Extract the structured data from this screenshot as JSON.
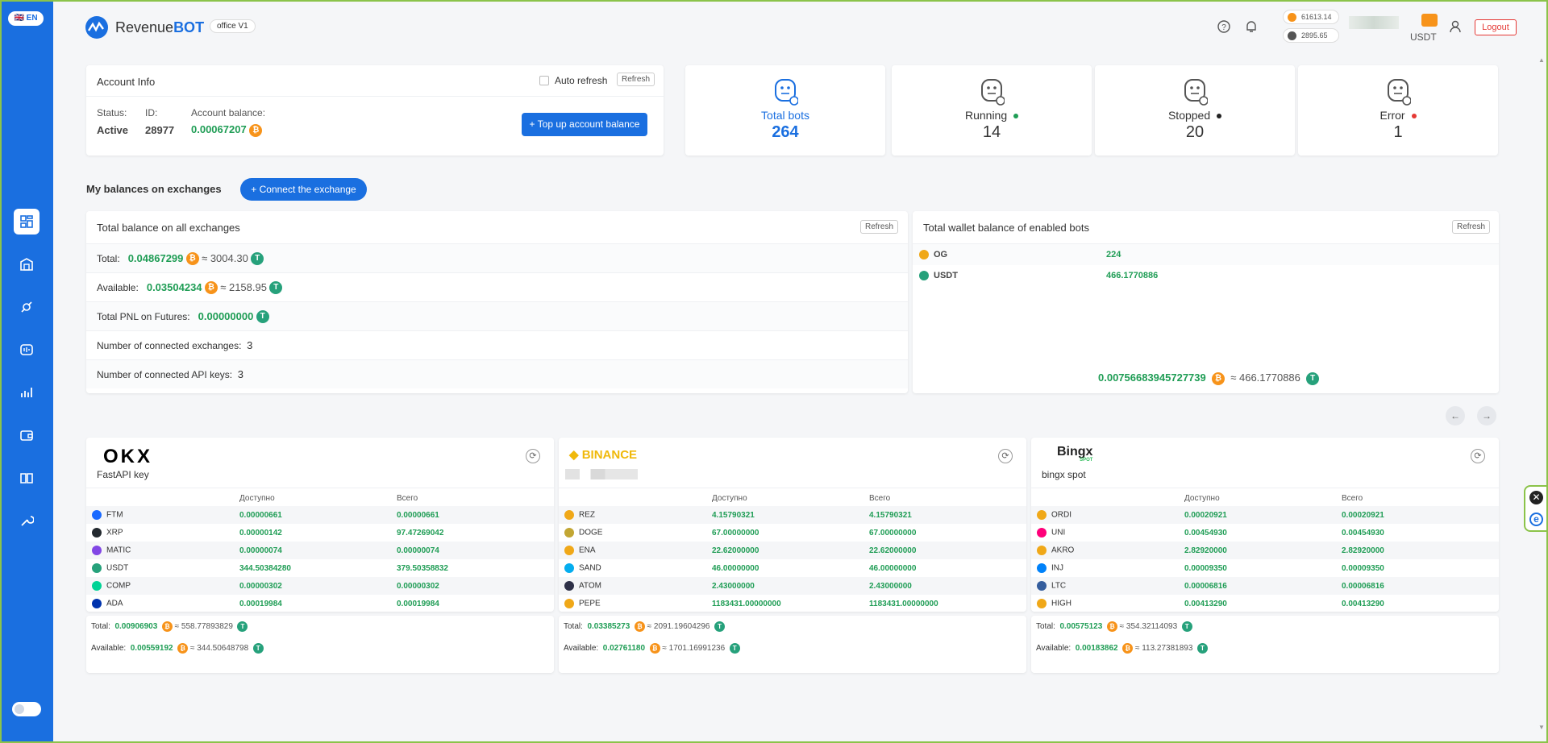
{
  "sidebar": {
    "lang": "🇬🇧 EN"
  },
  "header": {
    "logo_text": "Revenue",
    "logo_bold": "BOT",
    "office": "office V1",
    "btc_price": "61613.14",
    "eth_price": "2895.65",
    "currency": "USDT",
    "logout": "Logout"
  },
  "account": {
    "title": "Account Info",
    "auto_refresh": "Auto refresh",
    "refresh": "Refresh",
    "status_label": "Status:",
    "status_value": "Active",
    "id_label": "ID:",
    "id_value": "28977",
    "balance_label": "Account balance:",
    "balance_value": "0.00067207",
    "topup": "+ Top up account balance"
  },
  "stats": [
    {
      "label": "Total bots",
      "value": "264",
      "dot": ""
    },
    {
      "label": "Running",
      "value": "14",
      "dot": "#1f9d55"
    },
    {
      "label": "Stopped",
      "value": "20",
      "dot": "#222222"
    },
    {
      "label": "Error",
      "value": "1",
      "dot": "#e53935"
    }
  ],
  "balances": {
    "section_title": "My balances on exchanges",
    "connect": "+ Connect the exchange",
    "total_title": "Total balance on all exchanges",
    "refresh": "Refresh",
    "total_label": "Total:",
    "total_btc": "0.04867299",
    "total_usdt": "≈ 3004.30",
    "available_label": "Available:",
    "available_btc": "0.03504234",
    "available_usdt": "≈ 2158.95",
    "pnl_label": "Total PNL on Futures:",
    "pnl_value": "0.00000000",
    "exchanges_label": "Number of connected exchanges:",
    "exchanges_value": "3",
    "api_label": "Number of connected API keys:",
    "api_value": "3"
  },
  "wallet": {
    "title": "Total wallet balance of enabled bots",
    "refresh": "Refresh",
    "rows": [
      {
        "symbol": "OG",
        "value": "224",
        "color": "#f0a818"
      },
      {
        "symbol": "USDT",
        "value": "466.1770886",
        "color": "#26a17b"
      }
    ],
    "total_btc": "0.00756683945727739",
    "total_usdt": "≈ 466.1770886"
  },
  "exchanges": [
    {
      "brand": "OKX",
      "name": "FastAPI key",
      "col_available": "Доступно",
      "col_total": "Всего",
      "rows": [
        {
          "sym": "FTM",
          "avail": "0.00000661",
          "total": "0.00000661",
          "color": "#1969ff"
        },
        {
          "sym": "XRP",
          "avail": "0.00000142",
          "total": "97.47269042",
          "color": "#23292f"
        },
        {
          "sym": "MATIC",
          "avail": "0.00000074",
          "total": "0.00000074",
          "color": "#8247e5"
        },
        {
          "sym": "USDT",
          "avail": "344.50384280",
          "total": "379.50358832",
          "color": "#26a17b"
        },
        {
          "sym": "COMP",
          "avail": "0.00000302",
          "total": "0.00000302",
          "color": "#00d395"
        },
        {
          "sym": "ADA",
          "avail": "0.00019984",
          "total": "0.00019984",
          "color": "#0033ad"
        }
      ],
      "total_label": "Total:",
      "total_btc": "0.00906903",
      "total_usdt": "≈ 558.77893829",
      "avail_label": "Available:",
      "avail_btc": "0.00559192",
      "avail_usdt": "≈ 344.50648798"
    },
    {
      "brand": "BINANCE",
      "name": "",
      "col_available": "Доступно",
      "col_total": "Всего",
      "rows": [
        {
          "sym": "REZ",
          "avail": "4.15790321",
          "total": "4.15790321",
          "color": "#f0a818"
        },
        {
          "sym": "DOGE",
          "avail": "67.00000000",
          "total": "67.00000000",
          "color": "#c2a633"
        },
        {
          "sym": "ENA",
          "avail": "22.62000000",
          "total": "22.62000000",
          "color": "#f0a818"
        },
        {
          "sym": "SAND",
          "avail": "46.00000000",
          "total": "46.00000000",
          "color": "#04adef"
        },
        {
          "sym": "ATOM",
          "avail": "2.43000000",
          "total": "2.43000000",
          "color": "#2e3148"
        },
        {
          "sym": "PEPE",
          "avail": "1183431.00000000",
          "total": "1183431.00000000",
          "color": "#f0a818"
        }
      ],
      "total_label": "Total:",
      "total_btc": "0.03385273",
      "total_usdt": "≈ 2091.19604296",
      "avail_label": "Available:",
      "avail_btc": "0.02761180",
      "avail_usdt": "≈ 1701.16991236"
    },
    {
      "brand": "Bingx",
      "brand_sub": "SPOT",
      "name": "bingx spot",
      "col_available": "Доступно",
      "col_total": "Всего",
      "rows": [
        {
          "sym": "ORDI",
          "avail": "0.00020921",
          "total": "0.00020921",
          "color": "#f0a818"
        },
        {
          "sym": "UNI",
          "avail": "0.00454930",
          "total": "0.00454930",
          "color": "#ff007a"
        },
        {
          "sym": "AKRO",
          "avail": "2.82920000",
          "total": "2.82920000",
          "color": "#f0a818"
        },
        {
          "sym": "INJ",
          "avail": "0.00009350",
          "total": "0.00009350",
          "color": "#0082fa"
        },
        {
          "sym": "LTC",
          "avail": "0.00006816",
          "total": "0.00006816",
          "color": "#345d9d"
        },
        {
          "sym": "HIGH",
          "avail": "0.00413290",
          "total": "0.00413290",
          "color": "#f0a818"
        }
      ],
      "total_label": "Total:",
      "total_btc": "0.00575123",
      "total_usdt": "≈ 354.32114093",
      "avail_label": "Available:",
      "avail_btc": "0.00183862",
      "avail_usdt": "≈ 113.27381893"
    }
  ]
}
